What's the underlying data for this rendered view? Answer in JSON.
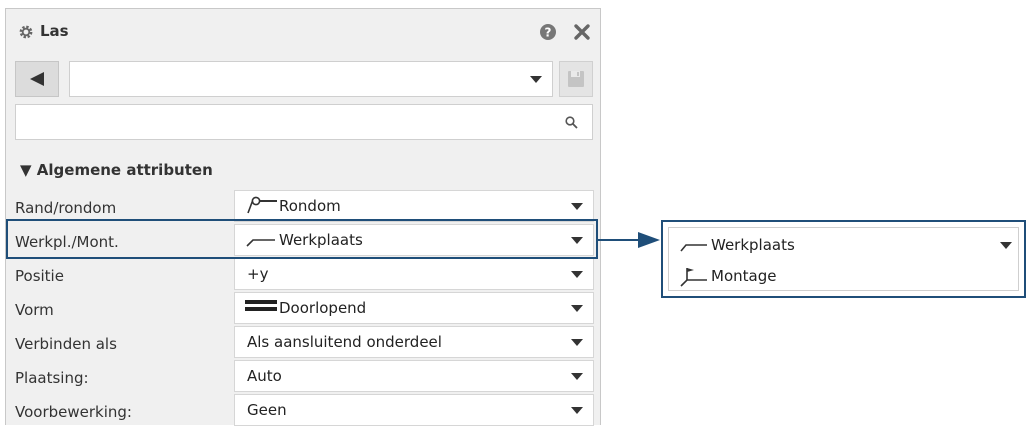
{
  "window": {
    "title": "Las",
    "icons": {
      "title": "gear-icon",
      "help": "help-icon",
      "close": "close-icon"
    }
  },
  "toolbar": {
    "back_icon": "back-arrow-icon",
    "preset_value": "",
    "save_icon": "save-icon"
  },
  "search": {
    "value": "",
    "icon": "search-icon"
  },
  "section": {
    "label": "Algemene attributen",
    "expanded": true
  },
  "attributes": [
    {
      "label": "Rand/rondom",
      "value": "Rondom",
      "icon": "weld-all-around-icon"
    },
    {
      "label": "Werkpl./Mont.",
      "value": "Werkplaats",
      "icon": "weld-shop-icon",
      "highlighted": true
    },
    {
      "label": "Positie",
      "value": "+y"
    },
    {
      "label": "Vorm",
      "value": "Doorlopend",
      "icon": "continuous-line-icon"
    },
    {
      "label": "Verbinden als",
      "value": "Als aansluitend onderdeel"
    },
    {
      "label": "Plaatsing:",
      "value": "Auto"
    },
    {
      "label": "Voorbewerking:",
      "value": "Geen"
    }
  ],
  "dropdown_popup": {
    "options": [
      {
        "value": "Werkplaats",
        "icon": "weld-shop-icon",
        "selected": true
      },
      {
        "value": "Montage",
        "icon": "weld-site-flag-icon"
      }
    ]
  },
  "colors": {
    "highlight_border": "#1f4e79",
    "panel_bg": "#f0f0f0"
  }
}
